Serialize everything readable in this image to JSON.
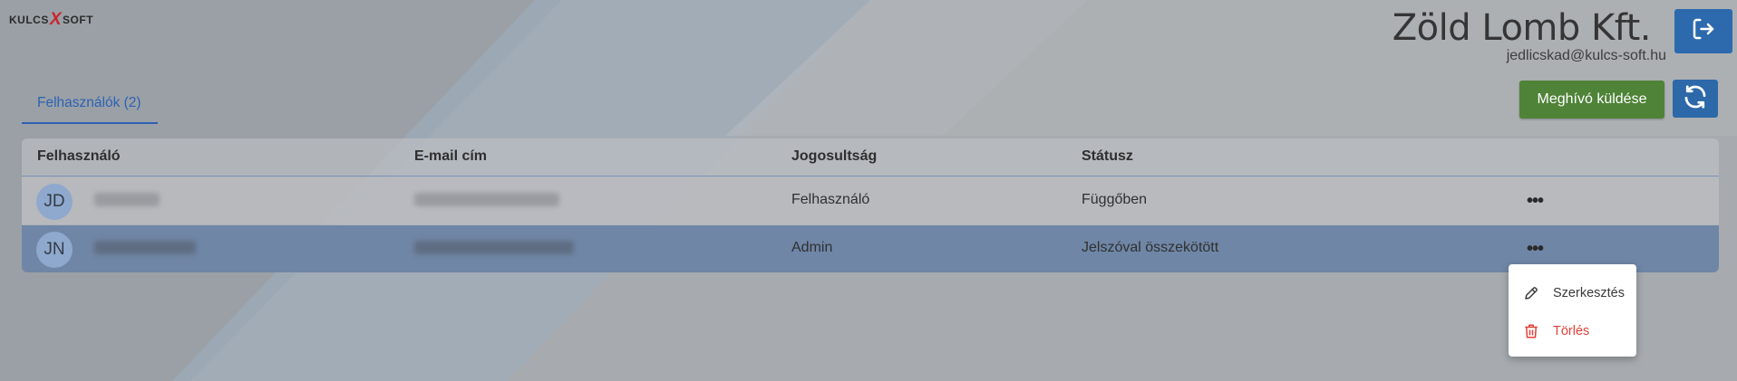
{
  "app": {
    "logo_left": "KULCS",
    "logo_mark": "X",
    "logo_right": "SOFT"
  },
  "header": {
    "company": "Zöld Lomb Kft.",
    "email": "jedlicskad@kulcs-soft.hu"
  },
  "actions": {
    "invite_label": "Meghívó küldése"
  },
  "tabs": [
    {
      "label": "Felhasználók (2)",
      "active": true
    }
  ],
  "table": {
    "columns": [
      "Felhasználó",
      "E-mail cím",
      "Jogosultság",
      "Státusz"
    ],
    "rows": [
      {
        "initials": "JD",
        "role": "Felhasználó",
        "status": "Függőben",
        "more": "•••"
      },
      {
        "initials": "JN",
        "role": "Admin",
        "status": "Jelszóval összekötött",
        "more": "•••",
        "selected": true
      }
    ]
  },
  "context_menu": {
    "items": [
      {
        "label": "Szerkesztés",
        "icon": "pencil-icon"
      },
      {
        "label": "Törlés",
        "icon": "trash-icon",
        "color": "#e4403b"
      }
    ]
  },
  "colors": {
    "accent": "#2c6aad",
    "invite": "#4f8338",
    "danger": "#e4403b",
    "selected_row": "#6f86a6"
  }
}
